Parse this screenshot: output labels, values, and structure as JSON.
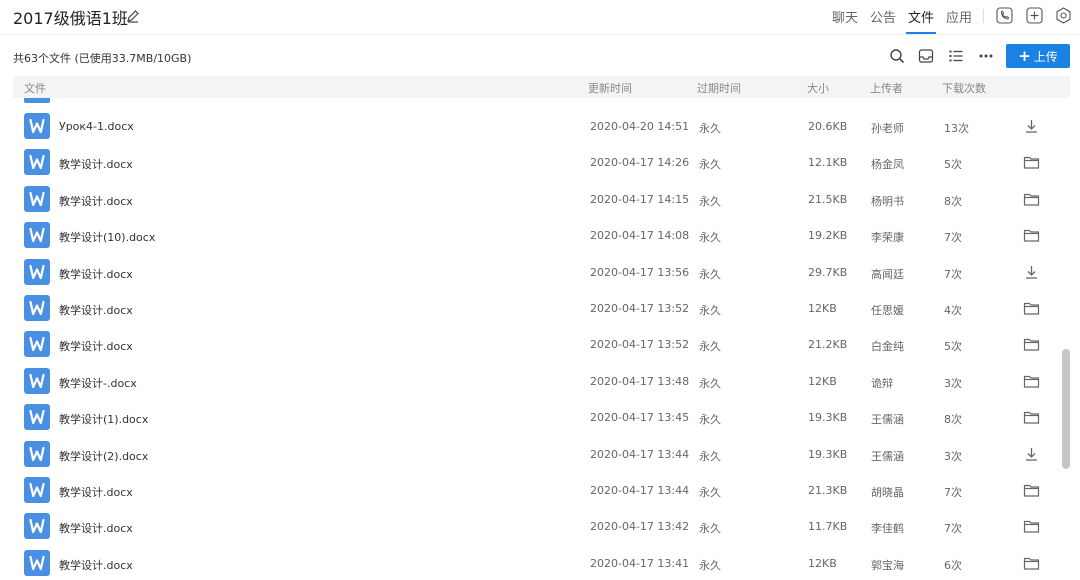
{
  "header": {
    "group_title": "2017级俄语1班",
    "tabs": [
      {
        "label": "聊天",
        "active": false
      },
      {
        "label": "公告",
        "active": false
      },
      {
        "label": "文件",
        "active": true
      },
      {
        "label": "应用",
        "active": false
      }
    ],
    "icons": [
      "phone-icon",
      "add-box-icon",
      "settings-icon"
    ]
  },
  "toolbar": {
    "summary": "共63个文件 (已使用33.7MB/10GB)",
    "icons": [
      "search-icon",
      "inbox-icon",
      "list-view-icon",
      "more-icon"
    ],
    "upload_label": "上传"
  },
  "table": {
    "columns": {
      "name": "文件",
      "updated": "更新时间",
      "expires": "过期时间",
      "size": "大小",
      "uploader": "上传者",
      "downloads": "下载次数"
    },
    "rows": [
      {
        "name": "Урок4-1.docx",
        "updated": "2020-04-20 14:51",
        "expires": "永久",
        "size": "20.6KB",
        "uploader": "孙老师",
        "downloads": "13次",
        "action": "download-icon"
      },
      {
        "name": "教学设计.docx",
        "updated": "2020-04-17 14:26",
        "expires": "永久",
        "size": "12.1KB",
        "uploader": "杨金凤",
        "downloads": "5次",
        "action": "folder-icon"
      },
      {
        "name": "教学设计.docx",
        "updated": "2020-04-17 14:15",
        "expires": "永久",
        "size": "21.5KB",
        "uploader": "杨明书",
        "downloads": "8次",
        "action": "folder-icon"
      },
      {
        "name": "教学设计(10).docx",
        "updated": "2020-04-17 14:08",
        "expires": "永久",
        "size": "19.2KB",
        "uploader": "李荣康",
        "downloads": "7次",
        "action": "folder-icon"
      },
      {
        "name": "教学设计.docx",
        "updated": "2020-04-17 13:56",
        "expires": "永久",
        "size": "29.7KB",
        "uploader": "高闻廷",
        "downloads": "7次",
        "action": "download-icon"
      },
      {
        "name": "教学设计.docx",
        "updated": "2020-04-17 13:52",
        "expires": "永久",
        "size": "12KB",
        "uploader": "任思媛",
        "downloads": "4次",
        "action": "folder-icon"
      },
      {
        "name": "教学设计.docx",
        "updated": "2020-04-17 13:52",
        "expires": "永久",
        "size": "21.2KB",
        "uploader": "白金纯",
        "downloads": "5次",
        "action": "folder-icon"
      },
      {
        "name": "教学设计-.docx",
        "updated": "2020-04-17 13:48",
        "expires": "永久",
        "size": "12KB",
        "uploader": "诡辩",
        "downloads": "3次",
        "action": "folder-icon"
      },
      {
        "name": "教学设计(1).docx",
        "updated": "2020-04-17 13:45",
        "expires": "永久",
        "size": "19.3KB",
        "uploader": "王儒涵",
        "downloads": "8次",
        "action": "folder-icon"
      },
      {
        "name": "教学设计(2).docx",
        "updated": "2020-04-17 13:44",
        "expires": "永久",
        "size": "19.3KB",
        "uploader": "王儒涵",
        "downloads": "3次",
        "action": "download-icon"
      },
      {
        "name": "教学设计.docx",
        "updated": "2020-04-17 13:44",
        "expires": "永久",
        "size": "21.3KB",
        "uploader": "胡晓晶",
        "downloads": "7次",
        "action": "folder-icon"
      },
      {
        "name": "教学设计.docx",
        "updated": "2020-04-17 13:42",
        "expires": "永久",
        "size": "11.7KB",
        "uploader": "李佳鹤",
        "downloads": "7次",
        "action": "folder-icon"
      },
      {
        "name": "教学设计.docx",
        "updated": "2020-04-17 13:41",
        "expires": "永久",
        "size": "12KB",
        "uploader": "郭宝海",
        "downloads": "6次",
        "action": "folder-icon"
      }
    ]
  },
  "colors": {
    "accent": "#1a82e2",
    "file_icon": "#4a90e2",
    "header_row": "#f3f4f6"
  }
}
